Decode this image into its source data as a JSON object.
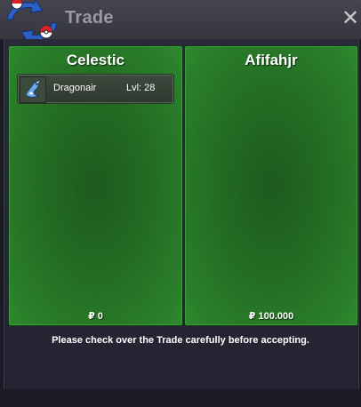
{
  "window": {
    "title": "Trade",
    "close_label": "✕"
  },
  "left_trader": {
    "name": "Celestic",
    "money": "₽ 0",
    "pokemon": [
      {
        "name": "Dragonair",
        "level": "Lvl: 28",
        "icon": "dragonair-icon"
      }
    ]
  },
  "right_trader": {
    "name": "Afifahjr",
    "money": "₽ 100.000",
    "pokemon": []
  },
  "notice": "Please check over the Trade carefully before accepting.",
  "colors": {
    "panel_green": "#2a7f2a",
    "window_bg": "#1b1b26",
    "title_text": "#9a9aa4"
  }
}
